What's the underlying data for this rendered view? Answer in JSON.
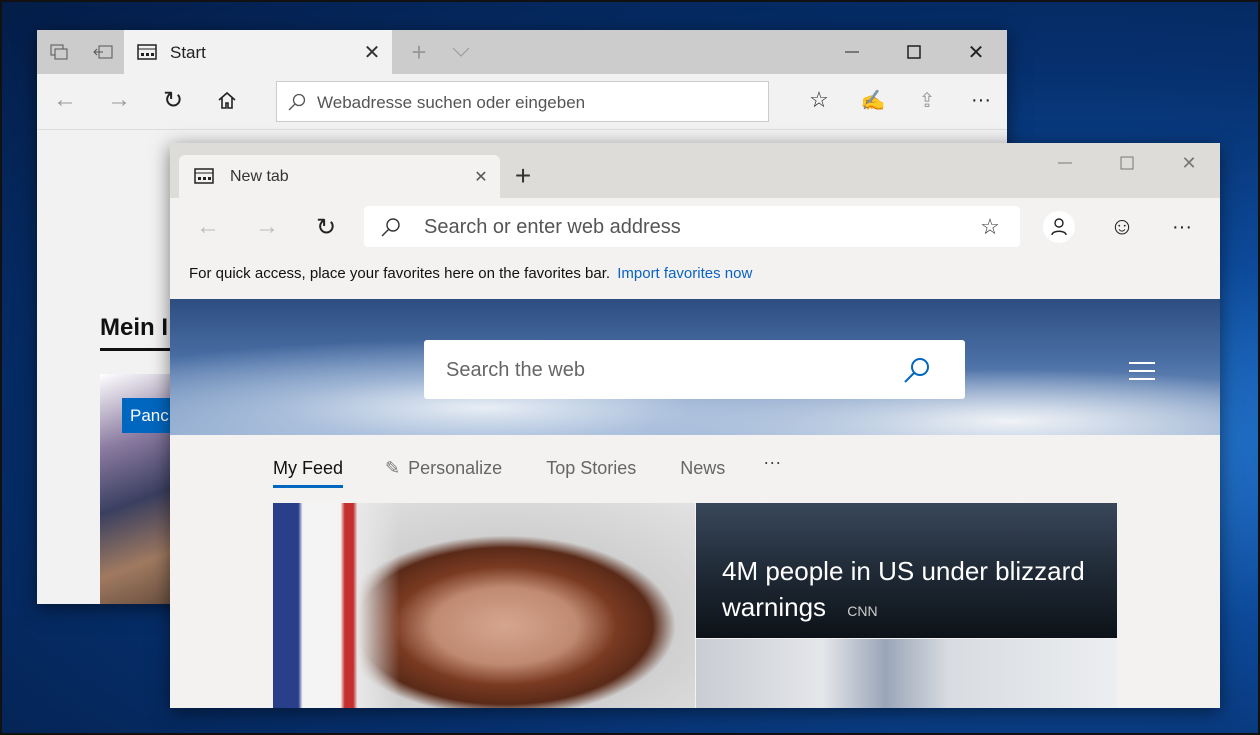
{
  "back_window": {
    "tab_title": "Start",
    "address_placeholder": "Webadresse suchen oder eingeben",
    "heading": "Mein I",
    "card_badge": "Panc"
  },
  "front_window": {
    "tab_title": "New tab",
    "address_placeholder": "Search or enter web address",
    "favorites_bar_text": "For quick access, place your favorites here on the favorites bar.",
    "import_link": "Import favorites now",
    "search_placeholder": "Search the web",
    "feed_tabs": [
      {
        "label": "My Feed",
        "active": true
      },
      {
        "label": "Personalize"
      },
      {
        "label": "Top Stories"
      },
      {
        "label": "News"
      },
      {
        "label": "···"
      }
    ],
    "stories": [
      {
        "headline": "4M people in US under blizzard warnings",
        "source": "CNN"
      }
    ],
    "accent_color": "#0067c0",
    "link_color": "#0a62c4"
  }
}
